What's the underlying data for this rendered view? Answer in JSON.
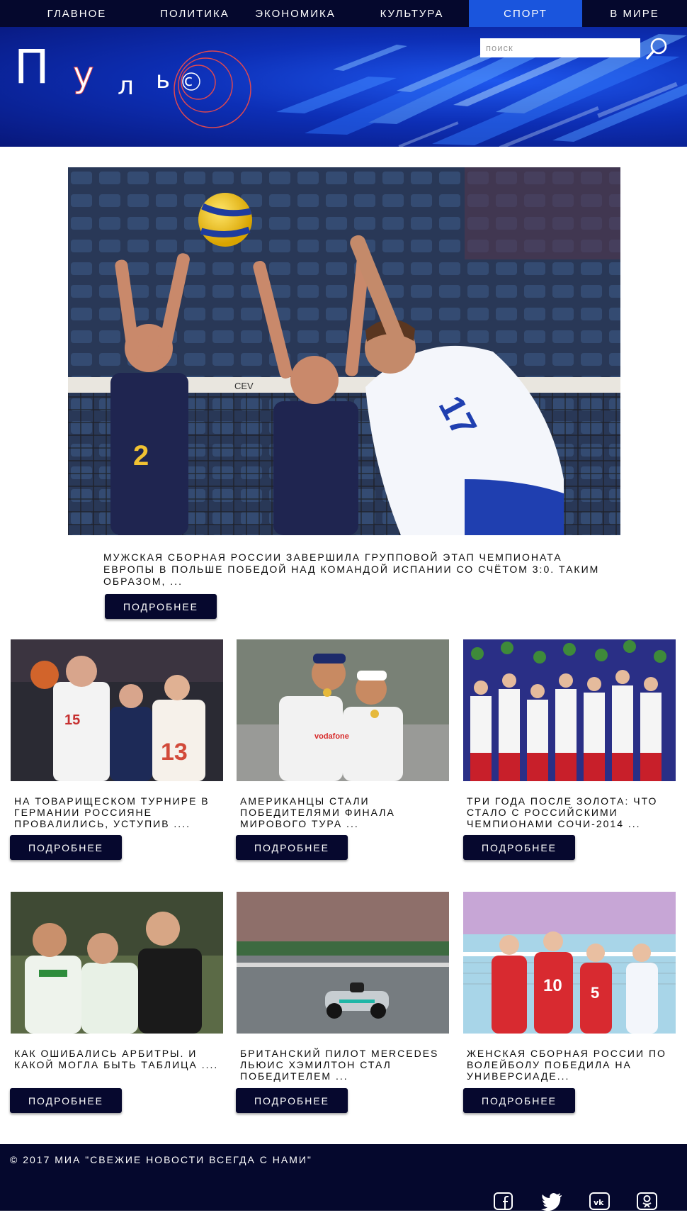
{
  "nav": {
    "items": [
      {
        "label": "ГЛАВНОЕ",
        "active": false
      },
      {
        "label": "ПОЛИТИКА",
        "active": false
      },
      {
        "label": "ЭКОНОМИКА",
        "active": false
      },
      {
        "label": "КУЛЬТУРА",
        "active": false
      },
      {
        "label": "СПОРТ",
        "active": true
      },
      {
        "label": "В МИРЕ",
        "active": false
      }
    ]
  },
  "header": {
    "logo_text": "Пульс",
    "search_placeholder": "поиск",
    "search_icon": "search-icon"
  },
  "hero": {
    "image": "volleyball-block-at-net",
    "text": "МУЖСКАЯ СБОРНАЯ РОССИИ ЗАВЕРШИЛА ГРУППОВОЙ ЭТАП ЧЕМПИОНАТА ЕВРОПЫ В ПОЛЬШЕ ПОБЕДОЙ НАД КОМАНДОЙ ИСПАНИИ СО СЧЁТОМ 3:0. ТАКИМ ОБРАЗОМ, ...",
    "button": "ПОДРОБНЕЕ"
  },
  "cards": [
    {
      "image": "basketball-players",
      "text": "НА ТОВАРИЩЕСКОМ ТУРНИРЕ В ГЕРМАНИИ РОССИЯНЕ ПРОВАЛИЛИСЬ, УСТУПИВ ....",
      "button": "ПОДРОБНЕЕ"
    },
    {
      "image": "beach-volleyball-champions",
      "text": "АМЕРИКАНЦЫ СТАЛИ ПОБЕДИТЕЛЯМИ ФИНАЛА МИРОВОГО ТУРА ...",
      "button": "ПОДРОБНЕЕ"
    },
    {
      "image": "olympic-podium-team",
      "text": "ТРИ ГОДА ПОСЛЕ ЗОЛОТА: ЧТО СТАЛО С РОССИЙСКИМИ ЧЕМПИОНАМИ СОЧИ-2014 ...",
      "button": "ПОДРОБНЕЕ"
    },
    {
      "image": "football-referee-argument",
      "text": "КАК ОШИБАЛИСЬ АРБИТРЫ. И КАКОЙ МОГЛА БЫТЬ ТАБЛИЦА ....",
      "button": "ПОДРОБНЕЕ"
    },
    {
      "image": "formula-one-car",
      "text": "БРИТАНСКИЙ ПИЛОТ MERCEDES ЛЬЮИС ХЭМИЛТОН СТАЛ ПОБЕДИТЕЛЕМ ...",
      "button": "ПОДРОБНЕЕ"
    },
    {
      "image": "women-volleyball-celebration",
      "text": "ЖЕНСКАЯ СБОРНАЯ РОССИИ ПО ВОЛЕЙБОЛУ ПОБЕДИЛА НА УНИВЕРСИАДЕ...",
      "button": "ПОДРОБНЕЕ"
    }
  ],
  "footer": {
    "copyright": "© 2017 МИА \"СВЕЖИЕ НОВОСТИ ВСЕГДА С НАМИ\"",
    "social": [
      "facebook-icon",
      "twitter-icon",
      "vk-icon",
      "odnoklassniki-icon"
    ]
  },
  "colors": {
    "nav_bg": "#05082d",
    "nav_active": "#1a55dd",
    "button_bg": "#06082e",
    "footer_bg": "#05082d",
    "logo_accent": "#e0484f"
  }
}
